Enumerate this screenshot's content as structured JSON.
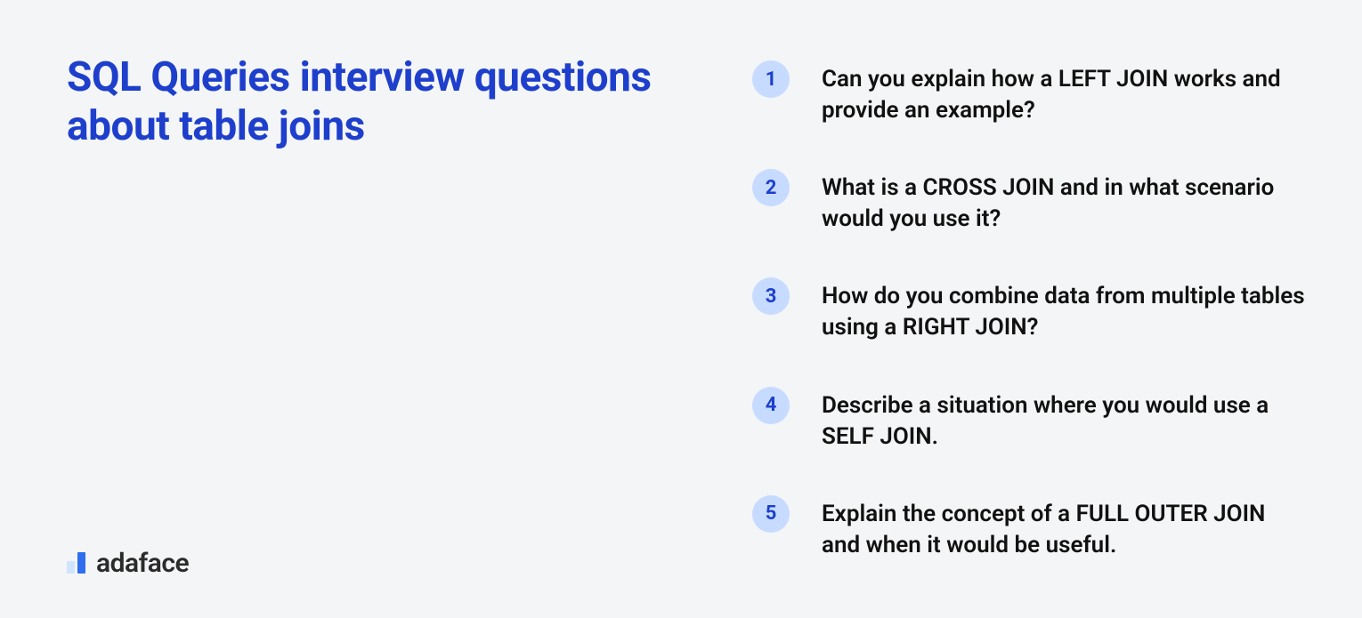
{
  "title": "SQL Queries interview questions about table joins",
  "brand": {
    "name": "adaface"
  },
  "questions": [
    {
      "num": "1",
      "text": "Can you explain how a LEFT JOIN works and provide an example?"
    },
    {
      "num": "2",
      "text": "What is a CROSS JOIN and in what scenario would you use it?"
    },
    {
      "num": "3",
      "text": "How do you combine data from multiple tables using a RIGHT JOIN?"
    },
    {
      "num": "4",
      "text": "Describe a situation where you would use a SELF JOIN."
    },
    {
      "num": "5",
      "text": "Explain the concept of a FULL OUTER JOIN and when it would be useful."
    }
  ]
}
